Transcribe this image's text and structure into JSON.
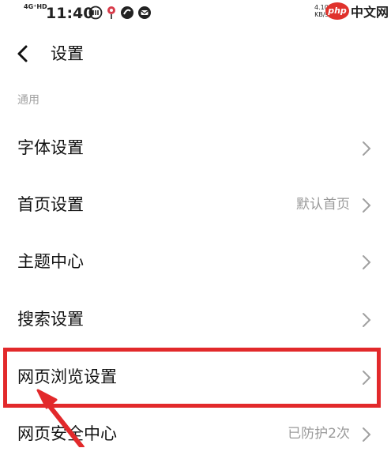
{
  "status_bar": {
    "network": "4G⁺HD",
    "time": "11:40",
    "speed_value": "4.10",
    "speed_unit": "KB/s"
  },
  "watermark": {
    "badge": "php",
    "text": "中文网"
  },
  "header": {
    "title": "设置"
  },
  "section": {
    "label": "通用"
  },
  "settings": [
    {
      "label": "字体设置",
      "value": ""
    },
    {
      "label": "首页设置",
      "value": "默认首页"
    },
    {
      "label": "主题中心",
      "value": ""
    },
    {
      "label": "搜索设置",
      "value": ""
    },
    {
      "label": "网页浏览设置",
      "value": ""
    },
    {
      "label": "网页安全中心",
      "value": "已防护2次"
    }
  ],
  "annotation": {
    "color": "#e2292b",
    "highlighted_item": "网页浏览设置"
  },
  "icons": {
    "back": "back-arrow-icon",
    "chevron": "chevron-right-icon"
  }
}
